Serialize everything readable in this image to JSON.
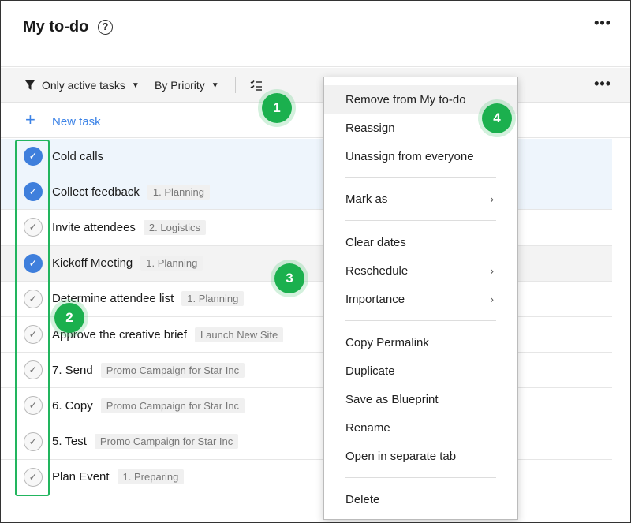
{
  "header": {
    "title": "My to-do",
    "help_icon": "?",
    "more": "•••"
  },
  "toolbar": {
    "filter_label": "Only active tasks",
    "priority_label": "By Priority",
    "more": "•••"
  },
  "new_task": {
    "plus": "+",
    "label": "New task"
  },
  "tasks": [
    {
      "name": "Cold calls",
      "tag": "",
      "done": true
    },
    {
      "name": "Collect feedback",
      "tag": "1. Planning",
      "done": true
    },
    {
      "name": "Invite attendees",
      "tag": "2. Logistics",
      "done": false
    },
    {
      "name": "Kickoff Meeting",
      "tag": "1. Planning",
      "done": true
    },
    {
      "name": "Determine attendee list",
      "tag": "1. Planning",
      "done": false
    },
    {
      "name": "Approve the creative brief",
      "tag": "Launch New Site",
      "done": false
    },
    {
      "name": "7. Send",
      "tag": "Promo Campaign for Star Inc",
      "done": false
    },
    {
      "name": "6. Copy",
      "tag": "Promo Campaign for Star Inc",
      "done": false
    },
    {
      "name": "5. Test",
      "tag": "Promo Campaign for Star Inc",
      "done": false
    },
    {
      "name": "Plan Event",
      "tag": "1. Preparing",
      "done": false
    }
  ],
  "context_menu": {
    "remove": "Remove from My to-do",
    "reassign": "Reassign",
    "unassign": "Unassign from everyone",
    "mark_as": "Mark as",
    "clear_dates": "Clear dates",
    "reschedule": "Reschedule",
    "importance": "Importance",
    "copy_permalink": "Copy Permalink",
    "duplicate": "Duplicate",
    "save_blueprint": "Save as Blueprint",
    "rename": "Rename",
    "open_tab": "Open in separate tab",
    "delete": "Delete",
    "submenu_arrow": "›"
  },
  "badges": {
    "b1": "1",
    "b2": "2",
    "b3": "3",
    "b4": "4"
  },
  "colors": {
    "accent": "#3b82e6",
    "highlight": "#1bb04e",
    "check_done": "#3f7fdc"
  }
}
